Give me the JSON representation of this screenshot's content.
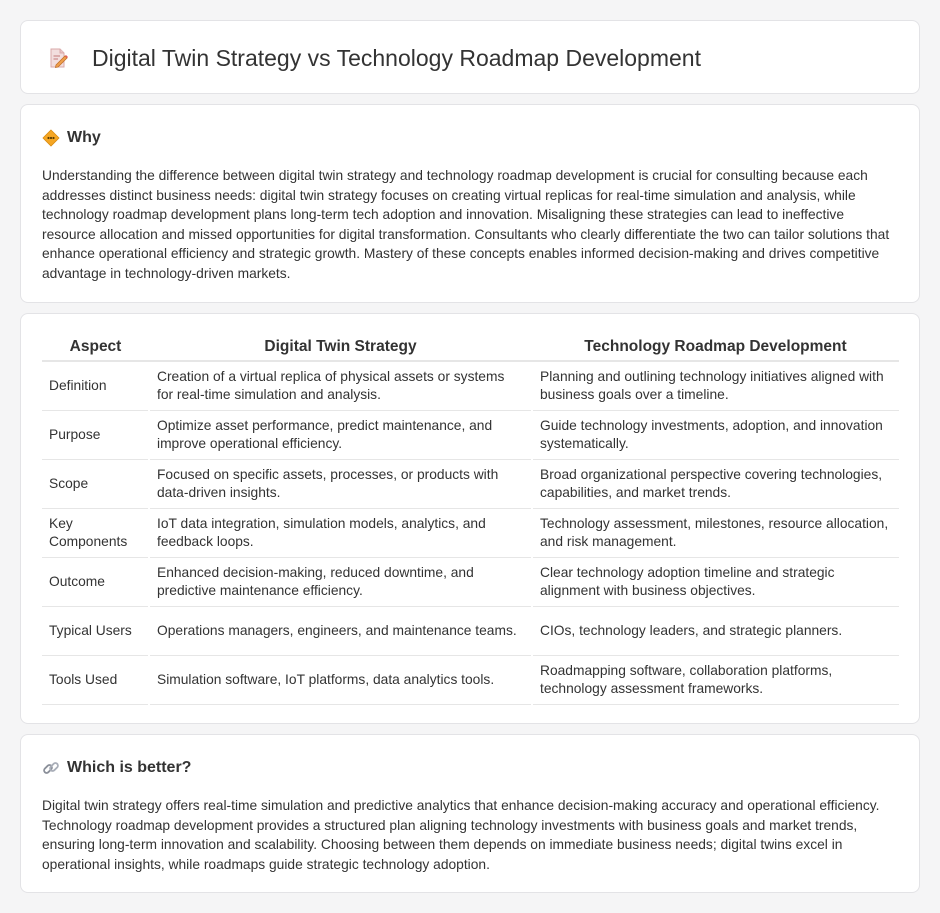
{
  "header": {
    "icon": "document-edit-icon",
    "title": "Digital Twin Strategy vs Technology Roadmap Development"
  },
  "why": {
    "icon": "warning-diamond-icon",
    "title": "Why",
    "body": "Understanding the difference between digital twin strategy and technology roadmap development is crucial for consulting because each addresses distinct business needs: digital twin strategy focuses on creating virtual replicas for real-time simulation and analysis, while technology roadmap development plans long-term tech adoption and innovation. Misaligning these strategies can lead to ineffective resource allocation and missed opportunities for digital transformation. Consultants who clearly differentiate the two can tailor solutions that enhance operational efficiency and strategic growth. Mastery of these concepts enables informed decision-making and drives competitive advantage in technology-driven markets."
  },
  "table": {
    "headers": [
      "Aspect",
      "Digital Twin Strategy",
      "Technology Roadmap Development"
    ],
    "rows": [
      [
        "Definition",
        "Creation of a virtual replica of physical assets or systems for real-time simulation and analysis.",
        "Planning and outlining technology initiatives aligned with business goals over a timeline."
      ],
      [
        "Purpose",
        "Optimize asset performance, predict maintenance, and improve operational efficiency.",
        "Guide technology investments, adoption, and innovation systematically."
      ],
      [
        "Scope",
        "Focused on specific assets, processes, or products with data-driven insights.",
        "Broad organizational perspective covering technologies, capabilities, and market trends."
      ],
      [
        "Key Components",
        "IoT data integration, simulation models, analytics, and feedback loops.",
        "Technology assessment, milestones, resource allocation, and risk management."
      ],
      [
        "Outcome",
        "Enhanced decision-making, reduced downtime, and predictive maintenance efficiency.",
        "Clear technology adoption timeline and strategic alignment with business objectives."
      ],
      [
        "Typical Users",
        "Operations managers, engineers, and maintenance teams.",
        "CIOs, technology leaders, and strategic planners."
      ],
      [
        "Tools Used",
        "Simulation software, IoT platforms, data analytics tools.",
        "Roadmapping software, collaboration platforms, technology assessment frameworks."
      ]
    ]
  },
  "better": {
    "icon": "link-icon",
    "title": "Which is better?",
    "body": "Digital twin strategy offers real-time simulation and predictive analytics that enhance decision-making accuracy and operational efficiency. Technology roadmap development provides a structured plan aligning technology investments with business goals and market trends, ensuring long-term innovation and scalability. Choosing between them depends on immediate business needs; digital twins excel in operational insights, while roadmaps guide strategic technology adoption."
  }
}
